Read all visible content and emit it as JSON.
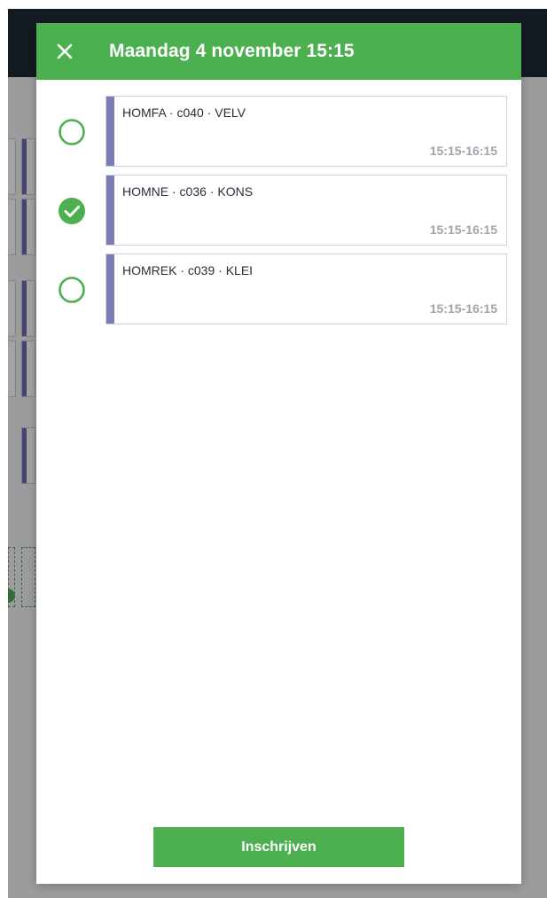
{
  "modal": {
    "title": "Maandag 4 november 15:15",
    "close_icon": "close-icon",
    "options": [
      {
        "label": "HOMFA · c040 · VELV",
        "time": "15:15-16:15",
        "selected": false
      },
      {
        "label": "HOMNE · c036 · KONS",
        "time": "15:15-16:15",
        "selected": true
      },
      {
        "label": "HOMREK · c039 · KLEI",
        "time": "15:15-16:15",
        "selected": false
      }
    ],
    "submit_label": "Inschrijven"
  },
  "colors": {
    "primary": "#4caf50",
    "accent_bar": "#7b7bb5",
    "header_bg": "#1f2a36",
    "time_text": "#a3a3ad"
  }
}
